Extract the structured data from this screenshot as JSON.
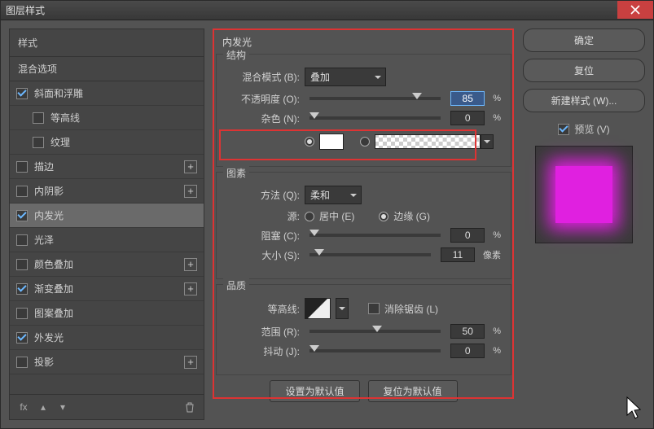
{
  "window": {
    "title": "图层样式"
  },
  "left": {
    "heading": "样式",
    "sub": "混合选项",
    "rows": [
      {
        "label": "斜面和浮雕",
        "checked": true,
        "plus": false
      },
      {
        "label": "等高线",
        "checked": false,
        "plus": false,
        "indent": true
      },
      {
        "label": "纹理",
        "checked": false,
        "plus": false,
        "indent": true
      },
      {
        "label": "描边",
        "checked": false,
        "plus": true
      },
      {
        "label": "内阴影",
        "checked": false,
        "plus": true
      },
      {
        "label": "内发光",
        "checked": true,
        "plus": false,
        "selected": true
      },
      {
        "label": "光泽",
        "checked": false,
        "plus": false
      },
      {
        "label": "颜色叠加",
        "checked": false,
        "plus": true
      },
      {
        "label": "渐变叠加",
        "checked": true,
        "plus": true
      },
      {
        "label": "图案叠加",
        "checked": false,
        "plus": false
      },
      {
        "label": "外发光",
        "checked": true,
        "plus": false
      },
      {
        "label": "投影",
        "checked": false,
        "plus": true
      }
    ]
  },
  "center": {
    "title": "内发光",
    "structure": {
      "title": "结构",
      "blend_label": "混合模式 (B):",
      "blend_value": "叠加",
      "opacity_label": "不透明度 (O):",
      "opacity_value": "85",
      "opacity_unit": "%",
      "noise_label": "杂色 (N):",
      "noise_value": "0",
      "noise_unit": "%"
    },
    "elements": {
      "title": "图素",
      "technique_label": "方法 (Q):",
      "technique_value": "柔和",
      "source_label": "源:",
      "center_label": "居中 (E)",
      "edge_label": "边缘 (G)",
      "choke_label": "阻塞 (C):",
      "choke_value": "0",
      "choke_unit": "%",
      "size_label": "大小 (S):",
      "size_value": "11",
      "size_unit": "像素"
    },
    "quality": {
      "title": "品质",
      "contour_label": "等高线:",
      "aa_label": "消除锯齿 (L)",
      "range_label": "范围 (R):",
      "range_value": "50",
      "range_unit": "%",
      "jitter_label": "抖动 (J):",
      "jitter_value": "0",
      "jitter_unit": "%"
    },
    "buttons": {
      "default": "设置为默认值",
      "reset": "复位为默认值"
    }
  },
  "right": {
    "ok": "确定",
    "cancel": "复位",
    "new_style": "新建样式 (W)...",
    "preview": "预览 (V)"
  }
}
